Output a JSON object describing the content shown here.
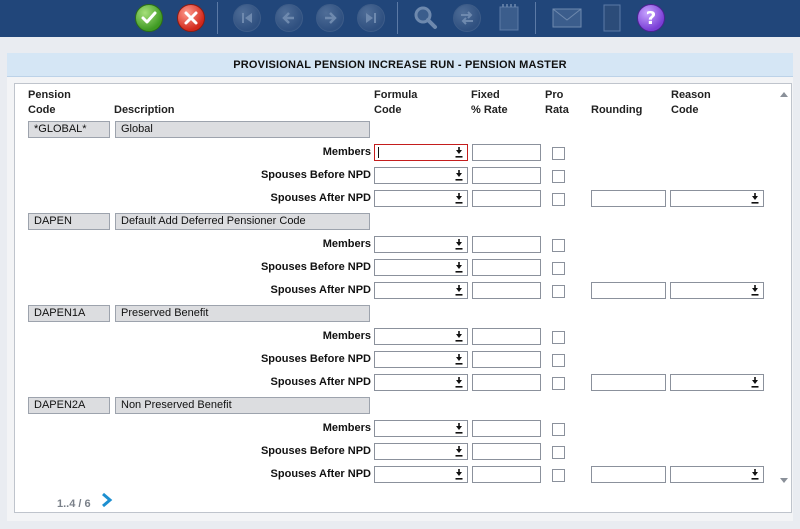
{
  "toolbar": {
    "icons": [
      "accept-icon",
      "cancel-icon",
      "first-record-icon",
      "previous-record-icon",
      "next-record-icon",
      "last-record-icon",
      "search-icon",
      "swap-icon",
      "notepad-icon",
      "mail-icon",
      "book-icon",
      "help-icon"
    ]
  },
  "panel": {
    "title": "PROVISIONAL PENSION INCREASE RUN - PENSION MASTER"
  },
  "columns": {
    "pension_code_1": "Pension",
    "pension_code_2": "Code",
    "description": "Description",
    "formula_1": "Formula",
    "formula_2": "Code",
    "fixed_1": "Fixed",
    "fixed_2": "% Rate",
    "pro_1": "Pro",
    "pro_2": "Rata",
    "rounding": "Rounding",
    "reason_1": "Reason",
    "reason_2": "Code"
  },
  "row_labels": {
    "members": "Members",
    "spouses_before": "Spouses Before NPD",
    "spouses_after": "Spouses After NPD"
  },
  "groups": [
    {
      "code": "*GLOBAL*",
      "description": "Global"
    },
    {
      "code": "DAPEN",
      "description": "Default Add Deferred Pensioner Code"
    },
    {
      "code": "DAPEN1A",
      "description": "Preserved Benefit"
    },
    {
      "code": "DAPEN2A",
      "description": "Non Preserved Benefit"
    }
  ],
  "pager": {
    "text": "1..4 / 6"
  },
  "colors": {
    "toolbar_bg": "#21467a",
    "header_bg": "#d5e6f5",
    "active_border": "#c41d1d"
  }
}
